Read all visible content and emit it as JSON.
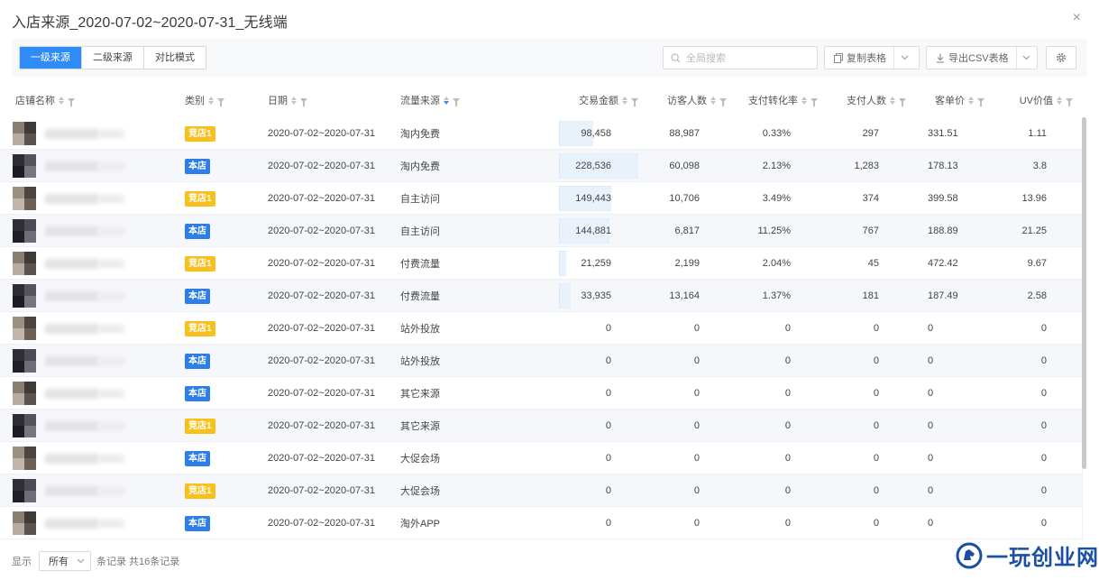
{
  "dialog": {
    "title": "入店来源_2020-07-02~2020-07-31_无线端",
    "close_label": "×"
  },
  "toolbar": {
    "tabs": [
      "一级来源",
      "二级来源",
      "对比模式"
    ],
    "active_tab": "一级来源",
    "search_placeholder": "全局搜索",
    "copy_label": "复制表格",
    "export_label": "导出CSV表格"
  },
  "table": {
    "columns": [
      "店铺名称",
      "类别",
      "日期",
      "流量来源",
      "交易金额",
      "访客人数",
      "支付转化率",
      "支付人数",
      "客单价",
      "UV价值"
    ],
    "rows": [
      {
        "category": "竞店1",
        "date": "2020-07-02~2020-07-31",
        "source": "淘内免费",
        "amount": "98,458",
        "visitors": "88,987",
        "conv": "0.33%",
        "payers": "297",
        "aov": "331.51",
        "uv": "1.11",
        "amount_value": 98458
      },
      {
        "category": "本店",
        "date": "2020-07-02~2020-07-31",
        "source": "淘内免费",
        "amount": "228,536",
        "visitors": "60,098",
        "conv": "2.13%",
        "payers": "1,283",
        "aov": "178.13",
        "uv": "3.8",
        "amount_value": 228536
      },
      {
        "category": "竞店1",
        "date": "2020-07-02~2020-07-31",
        "source": "自主访问",
        "amount": "149,443",
        "visitors": "10,706",
        "conv": "3.49%",
        "payers": "374",
        "aov": "399.58",
        "uv": "13.96",
        "amount_value": 149443
      },
      {
        "category": "本店",
        "date": "2020-07-02~2020-07-31",
        "source": "自主访问",
        "amount": "144,881",
        "visitors": "6,817",
        "conv": "11.25%",
        "payers": "767",
        "aov": "188.89",
        "uv": "21.25",
        "amount_value": 144881
      },
      {
        "category": "竞店1",
        "date": "2020-07-02~2020-07-31",
        "source": "付费流量",
        "amount": "21,259",
        "visitors": "2,199",
        "conv": "2.04%",
        "payers": "45",
        "aov": "472.42",
        "uv": "9.67",
        "amount_value": 21259
      },
      {
        "category": "本店",
        "date": "2020-07-02~2020-07-31",
        "source": "付费流量",
        "amount": "33,935",
        "visitors": "13,164",
        "conv": "1.37%",
        "payers": "181",
        "aov": "187.49",
        "uv": "2.58",
        "amount_value": 33935
      },
      {
        "category": "竞店1",
        "date": "2020-07-02~2020-07-31",
        "source": "站外投放",
        "amount": "0",
        "visitors": "0",
        "conv": "0",
        "payers": "0",
        "aov": "0",
        "uv": "0",
        "amount_value": 0
      },
      {
        "category": "本店",
        "date": "2020-07-02~2020-07-31",
        "source": "站外投放",
        "amount": "0",
        "visitors": "0",
        "conv": "0",
        "payers": "0",
        "aov": "0",
        "uv": "0",
        "amount_value": 0
      },
      {
        "category": "本店",
        "date": "2020-07-02~2020-07-31",
        "source": "其它来源",
        "amount": "0",
        "visitors": "0",
        "conv": "0",
        "payers": "0",
        "aov": "0",
        "uv": "0",
        "amount_value": 0
      },
      {
        "category": "竞店1",
        "date": "2020-07-02~2020-07-31",
        "source": "其它来源",
        "amount": "0",
        "visitors": "0",
        "conv": "0",
        "payers": "0",
        "aov": "0",
        "uv": "0",
        "amount_value": 0
      },
      {
        "category": "本店",
        "date": "2020-07-02~2020-07-31",
        "source": "大促会场",
        "amount": "0",
        "visitors": "0",
        "conv": "0",
        "payers": "0",
        "aov": "0",
        "uv": "0",
        "amount_value": 0
      },
      {
        "category": "竞店1",
        "date": "2020-07-02~2020-07-31",
        "source": "大促会场",
        "amount": "0",
        "visitors": "0",
        "conv": "0",
        "payers": "0",
        "aov": "0",
        "uv": "0",
        "amount_value": 0
      },
      {
        "category": "本店",
        "date": "2020-07-02~2020-07-31",
        "source": "淘外APP",
        "amount": "0",
        "visitors": "0",
        "conv": "0",
        "payers": "0",
        "aov": "0",
        "uv": "0",
        "amount_value": 0
      }
    ]
  },
  "footer": {
    "show_label": "显示",
    "page_size": "所有",
    "records_label": "条记录 共16条记录"
  },
  "watermark": {
    "text": "一玩创业网"
  },
  "colors": {
    "accent": "#2f8cf6",
    "badge_competitor": "#f7c01b",
    "badge_own": "#2d7ee8"
  }
}
